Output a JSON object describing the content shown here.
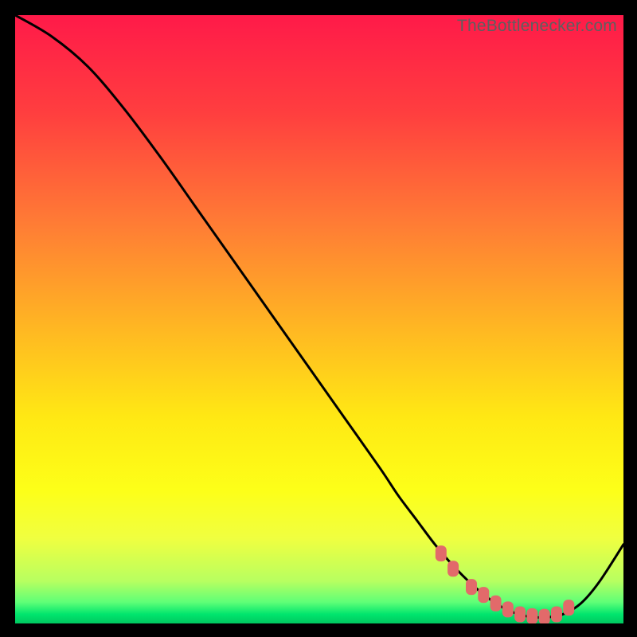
{
  "watermark": "TheBottlenecker.com",
  "chart_data": {
    "type": "line",
    "title": "",
    "xlabel": "",
    "ylabel": "",
    "xlim": [
      0,
      100
    ],
    "ylim": [
      0,
      100
    ],
    "gradient_stops": [
      {
        "offset": 0,
        "color": "#ff1a49"
      },
      {
        "offset": 0.16,
        "color": "#ff3e3f"
      },
      {
        "offset": 0.34,
        "color": "#ff7b35"
      },
      {
        "offset": 0.5,
        "color": "#ffb224"
      },
      {
        "offset": 0.66,
        "color": "#ffe814"
      },
      {
        "offset": 0.78,
        "color": "#fdff18"
      },
      {
        "offset": 0.86,
        "color": "#f0ff40"
      },
      {
        "offset": 0.93,
        "color": "#b8ff60"
      },
      {
        "offset": 0.965,
        "color": "#5fff77"
      },
      {
        "offset": 0.985,
        "color": "#00e56d"
      },
      {
        "offset": 1.0,
        "color": "#00c860"
      }
    ],
    "series": [
      {
        "name": "bottleneck-curve",
        "x": [
          0,
          6,
          12,
          18,
          24,
          30,
          36,
          42,
          48,
          54,
          60,
          63,
          66,
          69,
          72,
          75,
          78,
          81,
          84,
          87,
          90,
          93,
          96,
          100
        ],
        "y": [
          100,
          96.5,
          91.5,
          84.5,
          76.5,
          68,
          59.5,
          51,
          42.5,
          34,
          25.5,
          21,
          17,
          13,
          9.5,
          6.5,
          4,
          2.2,
          1.2,
          1,
          1.5,
          3.3,
          6.8,
          13
        ]
      },
      {
        "name": "optimal-markers",
        "type": "scatter",
        "x": [
          70,
          72,
          75,
          77,
          79,
          81,
          83,
          85,
          87,
          89,
          91
        ],
        "y": [
          11.5,
          9,
          6,
          4.7,
          3.3,
          2.3,
          1.5,
          1.2,
          1.1,
          1.5,
          2.6
        ]
      }
    ],
    "marker_color": "#e26a6a",
    "curve_color": "#000000"
  }
}
